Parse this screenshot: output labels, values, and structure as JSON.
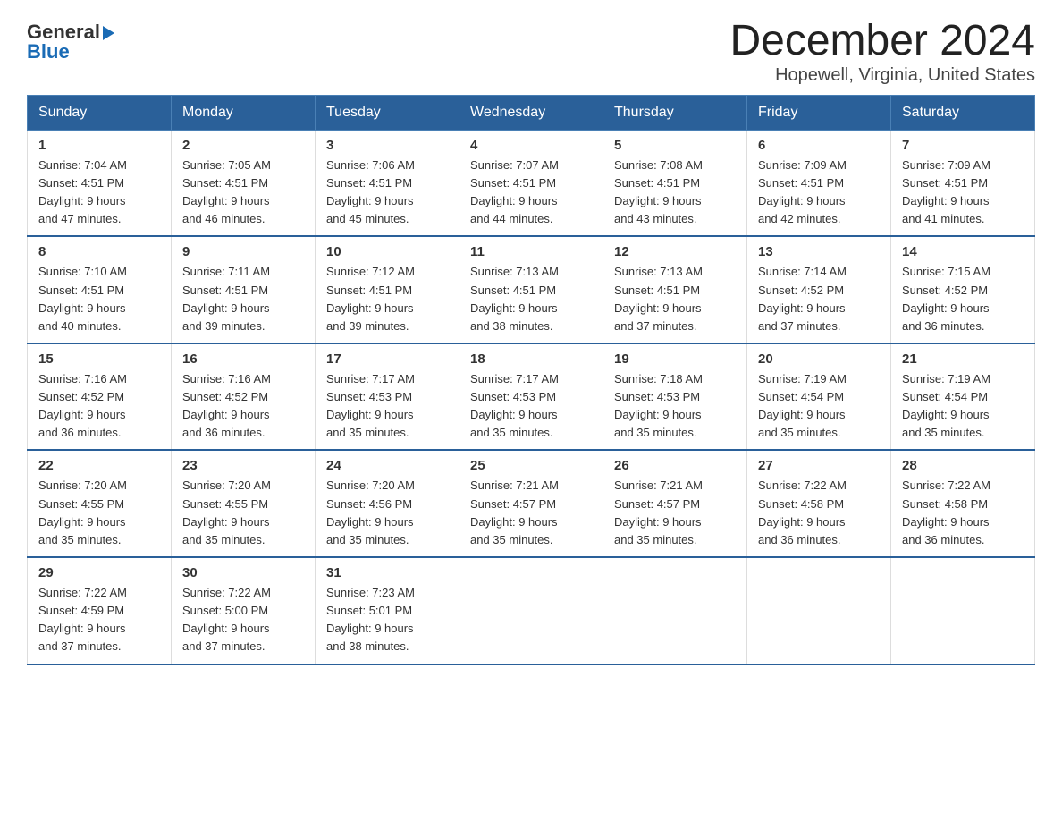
{
  "logo": {
    "general": "General",
    "blue": "Blue",
    "arrow": "▶"
  },
  "title": "December 2024",
  "location": "Hopewell, Virginia, United States",
  "days_of_week": [
    "Sunday",
    "Monday",
    "Tuesday",
    "Wednesday",
    "Thursday",
    "Friday",
    "Saturday"
  ],
  "weeks": [
    [
      {
        "day": "1",
        "sunrise": "7:04 AM",
        "sunset": "4:51 PM",
        "daylight": "9 hours and 47 minutes."
      },
      {
        "day": "2",
        "sunrise": "7:05 AM",
        "sunset": "4:51 PM",
        "daylight": "9 hours and 46 minutes."
      },
      {
        "day": "3",
        "sunrise": "7:06 AM",
        "sunset": "4:51 PM",
        "daylight": "9 hours and 45 minutes."
      },
      {
        "day": "4",
        "sunrise": "7:07 AM",
        "sunset": "4:51 PM",
        "daylight": "9 hours and 44 minutes."
      },
      {
        "day": "5",
        "sunrise": "7:08 AM",
        "sunset": "4:51 PM",
        "daylight": "9 hours and 43 minutes."
      },
      {
        "day": "6",
        "sunrise": "7:09 AM",
        "sunset": "4:51 PM",
        "daylight": "9 hours and 42 minutes."
      },
      {
        "day": "7",
        "sunrise": "7:09 AM",
        "sunset": "4:51 PM",
        "daylight": "9 hours and 41 minutes."
      }
    ],
    [
      {
        "day": "8",
        "sunrise": "7:10 AM",
        "sunset": "4:51 PM",
        "daylight": "9 hours and 40 minutes."
      },
      {
        "day": "9",
        "sunrise": "7:11 AM",
        "sunset": "4:51 PM",
        "daylight": "9 hours and 39 minutes."
      },
      {
        "day": "10",
        "sunrise": "7:12 AM",
        "sunset": "4:51 PM",
        "daylight": "9 hours and 39 minutes."
      },
      {
        "day": "11",
        "sunrise": "7:13 AM",
        "sunset": "4:51 PM",
        "daylight": "9 hours and 38 minutes."
      },
      {
        "day": "12",
        "sunrise": "7:13 AM",
        "sunset": "4:51 PM",
        "daylight": "9 hours and 37 minutes."
      },
      {
        "day": "13",
        "sunrise": "7:14 AM",
        "sunset": "4:52 PM",
        "daylight": "9 hours and 37 minutes."
      },
      {
        "day": "14",
        "sunrise": "7:15 AM",
        "sunset": "4:52 PM",
        "daylight": "9 hours and 36 minutes."
      }
    ],
    [
      {
        "day": "15",
        "sunrise": "7:16 AM",
        "sunset": "4:52 PM",
        "daylight": "9 hours and 36 minutes."
      },
      {
        "day": "16",
        "sunrise": "7:16 AM",
        "sunset": "4:52 PM",
        "daylight": "9 hours and 36 minutes."
      },
      {
        "day": "17",
        "sunrise": "7:17 AM",
        "sunset": "4:53 PM",
        "daylight": "9 hours and 35 minutes."
      },
      {
        "day": "18",
        "sunrise": "7:17 AM",
        "sunset": "4:53 PM",
        "daylight": "9 hours and 35 minutes."
      },
      {
        "day": "19",
        "sunrise": "7:18 AM",
        "sunset": "4:53 PM",
        "daylight": "9 hours and 35 minutes."
      },
      {
        "day": "20",
        "sunrise": "7:19 AM",
        "sunset": "4:54 PM",
        "daylight": "9 hours and 35 minutes."
      },
      {
        "day": "21",
        "sunrise": "7:19 AM",
        "sunset": "4:54 PM",
        "daylight": "9 hours and 35 minutes."
      }
    ],
    [
      {
        "day": "22",
        "sunrise": "7:20 AM",
        "sunset": "4:55 PM",
        "daylight": "9 hours and 35 minutes."
      },
      {
        "day": "23",
        "sunrise": "7:20 AM",
        "sunset": "4:55 PM",
        "daylight": "9 hours and 35 minutes."
      },
      {
        "day": "24",
        "sunrise": "7:20 AM",
        "sunset": "4:56 PM",
        "daylight": "9 hours and 35 minutes."
      },
      {
        "day": "25",
        "sunrise": "7:21 AM",
        "sunset": "4:57 PM",
        "daylight": "9 hours and 35 minutes."
      },
      {
        "day": "26",
        "sunrise": "7:21 AM",
        "sunset": "4:57 PM",
        "daylight": "9 hours and 35 minutes."
      },
      {
        "day": "27",
        "sunrise": "7:22 AM",
        "sunset": "4:58 PM",
        "daylight": "9 hours and 36 minutes."
      },
      {
        "day": "28",
        "sunrise": "7:22 AM",
        "sunset": "4:58 PM",
        "daylight": "9 hours and 36 minutes."
      }
    ],
    [
      {
        "day": "29",
        "sunrise": "7:22 AM",
        "sunset": "4:59 PM",
        "daylight": "9 hours and 37 minutes."
      },
      {
        "day": "30",
        "sunrise": "7:22 AM",
        "sunset": "5:00 PM",
        "daylight": "9 hours and 37 minutes."
      },
      {
        "day": "31",
        "sunrise": "7:23 AM",
        "sunset": "5:01 PM",
        "daylight": "9 hours and 38 minutes."
      },
      null,
      null,
      null,
      null
    ]
  ]
}
